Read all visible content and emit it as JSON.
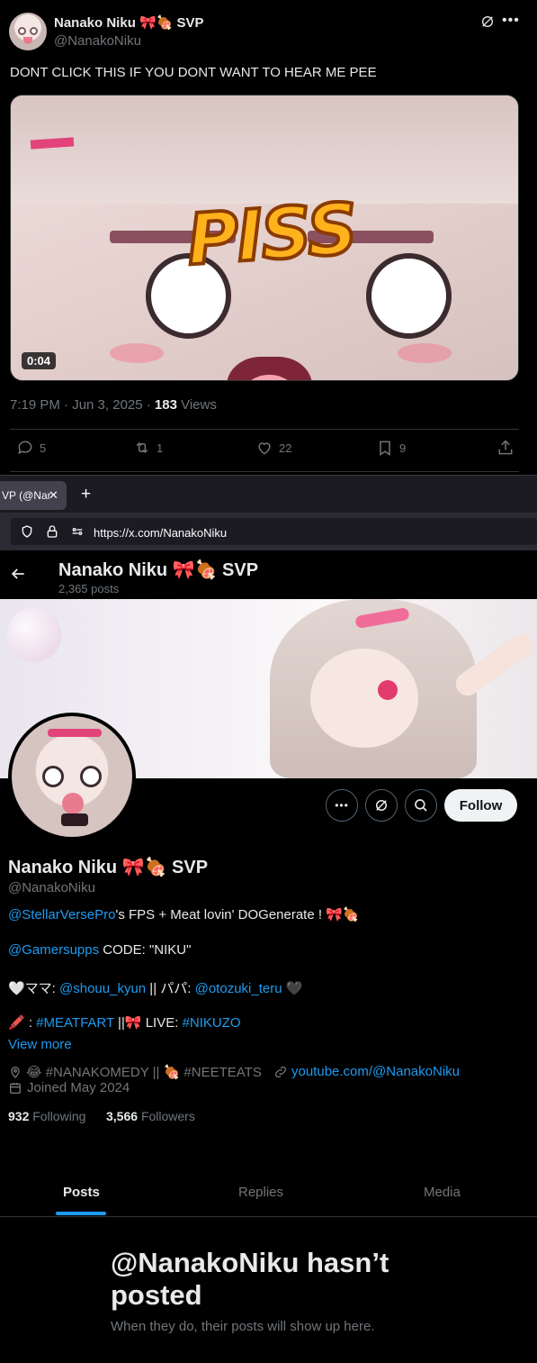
{
  "tweet": {
    "author_name": "Nanako Niku 🎀🍖 SVP",
    "author_handle": "@NanakoNiku",
    "text": "DONT CLICK THIS IF YOU DONT WANT TO HEAR ME PEE",
    "media": {
      "overlay_text": "PISS",
      "duration": "0:04"
    },
    "timestamp": "7:19 PM · Jun 3, 2025 · ",
    "views_count": "183",
    "views_label": " Views",
    "actions": {
      "replies": "5",
      "reposts": "1",
      "likes": "22",
      "bookmarks": "9"
    }
  },
  "browser": {
    "tab_title": "VP (@Nar",
    "url_prefix": "https://",
    "url_host": "x.com/NanakoNiku"
  },
  "profile": {
    "header_name": "Nanako Niku 🎀🍖 SVP",
    "posts_count": "2,365 posts",
    "follow_label": "Follow",
    "display_name": "Nanako Niku 🎀🍖 SVP",
    "handle": "@NanakoNiku",
    "bio": {
      "line1_mention": "@StellarVersePro",
      "line1_rest": "'s FPS + Meat lovin' DOGenerate ! 🎀🍖",
      "line2_mention": "@Gamersupps",
      "line2_rest": " CODE: \"NIKU\"",
      "line3_prefix": "🤍ママ: ",
      "line3_mention1": "@shouu_kyun",
      "line3_mid": " || パパ: ",
      "line3_mention2": "@otozuki_teru",
      "line3_suffix": " 🖤",
      "line4_prefix": "🖍️ : ",
      "line4_tag1": "#MEATFART",
      "line4_mid": " ||🎀 LIVE: ",
      "line4_tag2": "#NIKUZO"
    },
    "view_more": "View more",
    "location": "😂 #NANAKOMEDY || 🍖 #NEETEATS",
    "website": "youtube.com/@NanakoNiku",
    "joined": "Joined May 2024",
    "following_count": "932",
    "following_label": "Following",
    "followers_count": "3,566",
    "followers_label": "Followers",
    "tabs": [
      "Posts",
      "Replies",
      "Media"
    ],
    "empty_title": "@NanakoNiku hasn’t posted",
    "empty_subtitle": "When they do, their posts will show up here."
  },
  "colors": {
    "accent": "#1d9bf0",
    "muted": "#71767b",
    "text": "#e7e9ea",
    "background": "#000000"
  }
}
